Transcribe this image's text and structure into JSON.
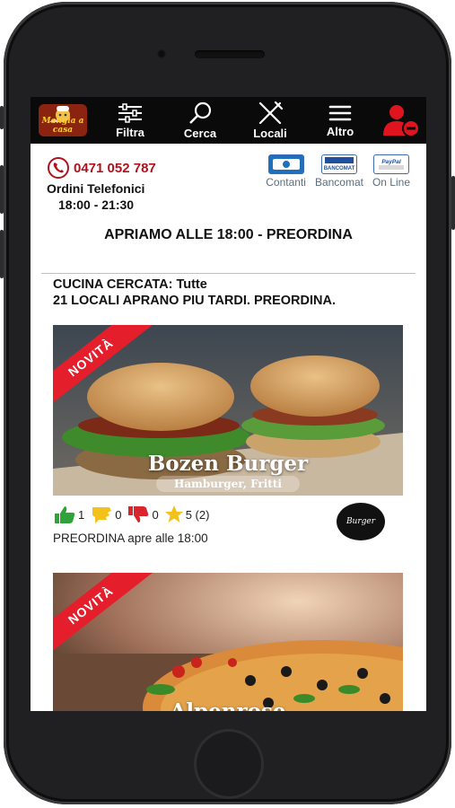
{
  "header": {
    "logo_text": "Mangia a casa",
    "nav": [
      {
        "label": "Filtra",
        "icon": "sliders-icon"
      },
      {
        "label": "Cerca",
        "icon": "search-icon"
      },
      {
        "label": "Locali",
        "icon": "fork-knife-icon"
      },
      {
        "label": "Altro",
        "icon": "menu-icon"
      }
    ],
    "user_icon": "user-logout-icon"
  },
  "contact": {
    "phone": "0471 052 787",
    "orders_label": "Ordini Telefonici",
    "hours": "18:00 - 21:30"
  },
  "payments": [
    {
      "label": "Contanti",
      "logo": "cash"
    },
    {
      "label": "Bancomat",
      "logo": "BANCOMAT"
    },
    {
      "label": "On Line",
      "logo": "PayPal"
    }
  ],
  "banner": "APRIAMO ALLE 18:00 - PREORDINA",
  "search": {
    "line1": "CUCINA CERCATA: Tutte",
    "line2": "21 LOCALI APRANO PIU TARDI. PREORDINA."
  },
  "restaurants": [
    {
      "badge": "NOVITÀ",
      "name": "Bozen Burger",
      "cuisine": "Hamburger, Fritti",
      "likes": "1",
      "neutral": "0",
      "dislikes": "0",
      "rating": "5 (2)",
      "logo_text": "Burger",
      "status": "PREORDINA apre alle 18:00"
    },
    {
      "badge": "NOVITÀ",
      "name": "Alpenrose"
    }
  ],
  "colors": {
    "topbar": "#0a0a0a",
    "phone_red": "#b0121b",
    "ribbon": "#e51e2b",
    "user_icon": "#e0141e"
  }
}
